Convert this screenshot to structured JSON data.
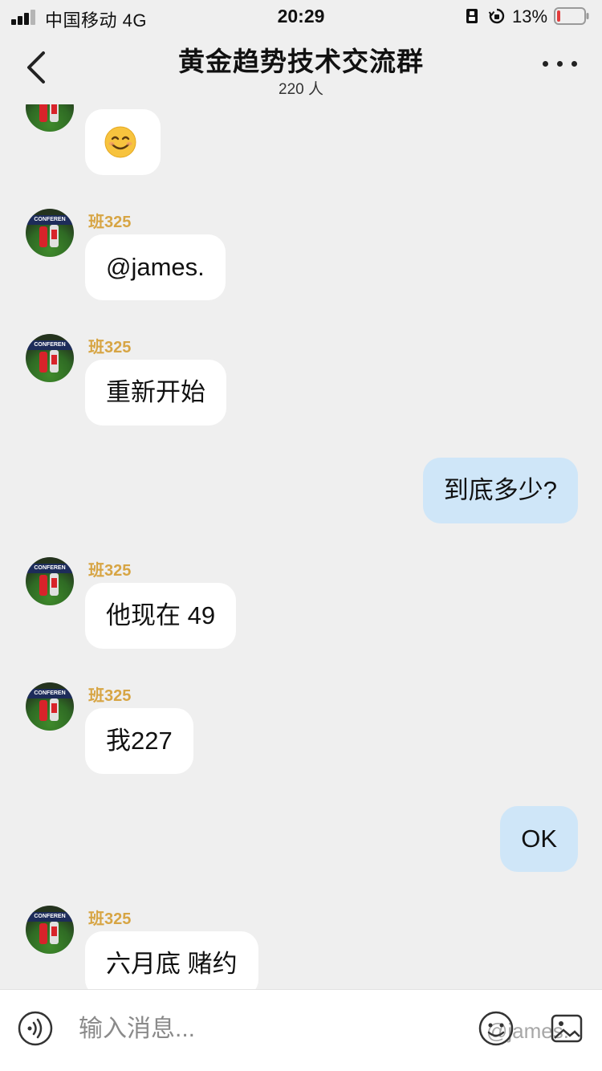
{
  "status_bar": {
    "carrier": "中国移动  4G",
    "time": "20:29",
    "battery_percent": "13%",
    "battery_level": 0.13,
    "battery_color": "#e23c3c"
  },
  "header": {
    "title": "黄金趋势技术交流群",
    "member_count": "220 人",
    "back_icon": "chevron-left-icon",
    "more_icon": "more-dots-icon"
  },
  "avatar": {
    "banner_text": "CONFEREN"
  },
  "messages": [
    {
      "from": "other",
      "sender": "",
      "text": "",
      "emoji": "smiling-face-icon"
    },
    {
      "from": "other",
      "sender": "班325",
      "text": "@james."
    },
    {
      "from": "other",
      "sender": "班325",
      "text": "重新开始"
    },
    {
      "from": "me",
      "sender": "",
      "text": "到底多少?"
    },
    {
      "from": "other",
      "sender": "班325",
      "text": "他现在 49"
    },
    {
      "from": "other",
      "sender": "班325",
      "text": "我227"
    },
    {
      "from": "me",
      "sender": "",
      "text": "OK"
    },
    {
      "from": "other",
      "sender": "班325",
      "text": "六月底 赌约"
    }
  ],
  "input_bar": {
    "placeholder": "输入消息...",
    "voice_icon": "voice-icon",
    "sticker_icon": "sticker-face-icon",
    "image_icon": "image-icon",
    "watermark": "@james."
  },
  "colors": {
    "background": "#efefef",
    "sender_name": "#d7a544",
    "my_bubble": "#cfe6f8",
    "their_bubble": "#ffffff"
  }
}
